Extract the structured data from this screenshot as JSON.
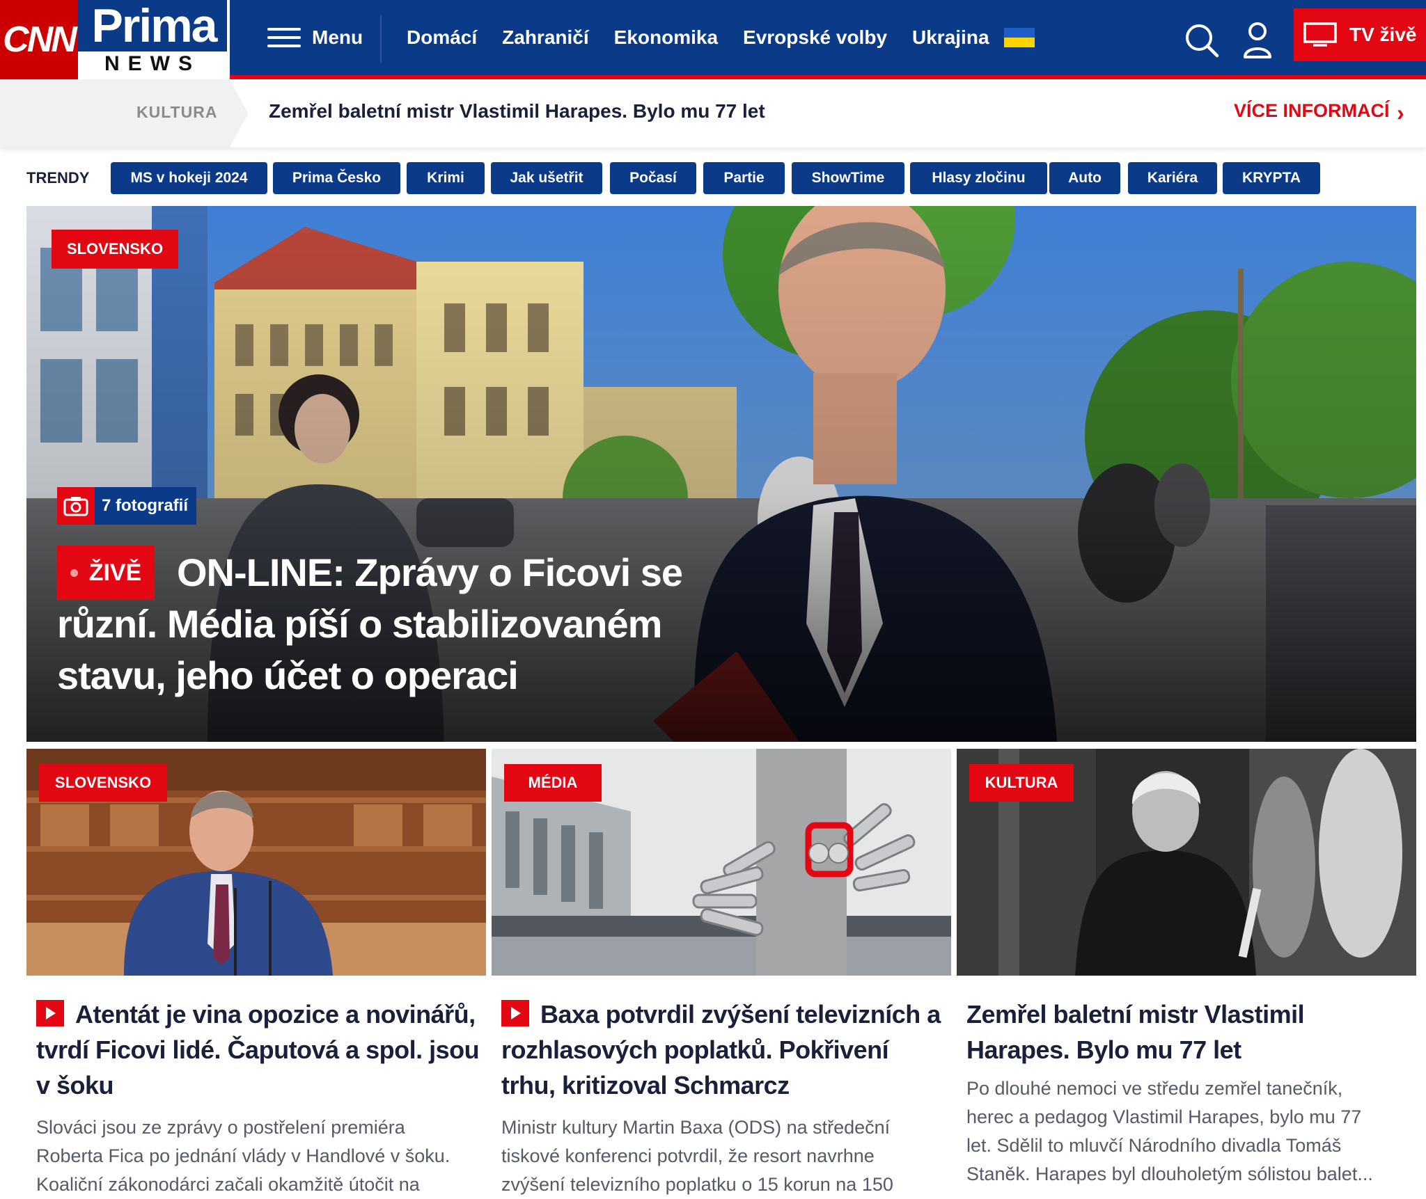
{
  "header": {
    "logo_cnn": "CNN",
    "logo_prima": "Prima",
    "logo_news": "NEWS",
    "menu_label": "Menu",
    "nav": [
      "Domácí",
      "Zahraničí",
      "Ekonomika",
      "Evropské volby",
      "Ukrajina"
    ],
    "tv_label": "TV živě"
  },
  "breaking": {
    "category": "KULTURA",
    "title": "Zemřel baletní mistr Vlastimil Harapes. Bylo mu 77 let",
    "more": "VÍCE INFORMACÍ"
  },
  "trends": {
    "label": "TRENDY",
    "items": [
      "MS v hokeji 2024",
      "Prima Česko",
      "Krimi",
      "Jak ušetřit",
      "Počasí",
      "Partie",
      "ShowTime",
      "Hlasy zločinu",
      "Auto",
      "Kariéra",
      "KRYPTA"
    ]
  },
  "hero": {
    "category": "SLOVENSKO",
    "photo_count": "7 fotografií",
    "live_label": "ŽIVĚ",
    "title": "ON-LINE: Zprávy o Ficovi se různí. Média píší o stabilizovaném stavu, jeho účet o operaci"
  },
  "articles": [
    {
      "category": "SLOVENSKO",
      "video": true,
      "title": "Atentát je vina opozice a novinářů, tvrdí Ficovi lidé. Čaputová a spol. jsou v šoku",
      "lines": [
        "Slováci jsou ze zprávy o postřelení premiéra",
        "Roberta Fica po jednání vlády v Handlové v šoku.",
        "Koaliční zákonodárci začali okamžitě útočit na"
      ]
    },
    {
      "category": "MÉDIA",
      "video": true,
      "title": "Baxa potvrdil zvýšení televizních a rozhlasových poplatků. Pokřivení trhu, kritizoval Schmarcz",
      "lines": [
        "Ministr kultury Martin Baxa (ODS) na středeční",
        "tiskové konferenci potvrdil, že resort navrhne",
        "zvýšení televizního poplatku o 15 korun na 150"
      ]
    },
    {
      "category": "KULTURA",
      "video": false,
      "title": "Zemřel baletní mistr Vlastimil Harapes. Bylo mu 77 let",
      "lines": [
        "Po dlouhé nemoci ve středu zemřel tanečník,",
        "herec a pedagog Vlastimil Harapes, bylo mu 77",
        "let. Sdělil to mluvčí Národního divadla Tomáš",
        "Staněk. Harapes byl dlouholetým sólistou balet..."
      ]
    }
  ],
  "colors": {
    "brand_blue": "#0b3a88",
    "accent_red": "#e30613"
  },
  "icons": [
    "hamburger-icon",
    "ukraine-flag-icon",
    "search-icon",
    "user-icon",
    "tv-icon",
    "chevron-right-icon",
    "camera-icon",
    "play-icon"
  ]
}
